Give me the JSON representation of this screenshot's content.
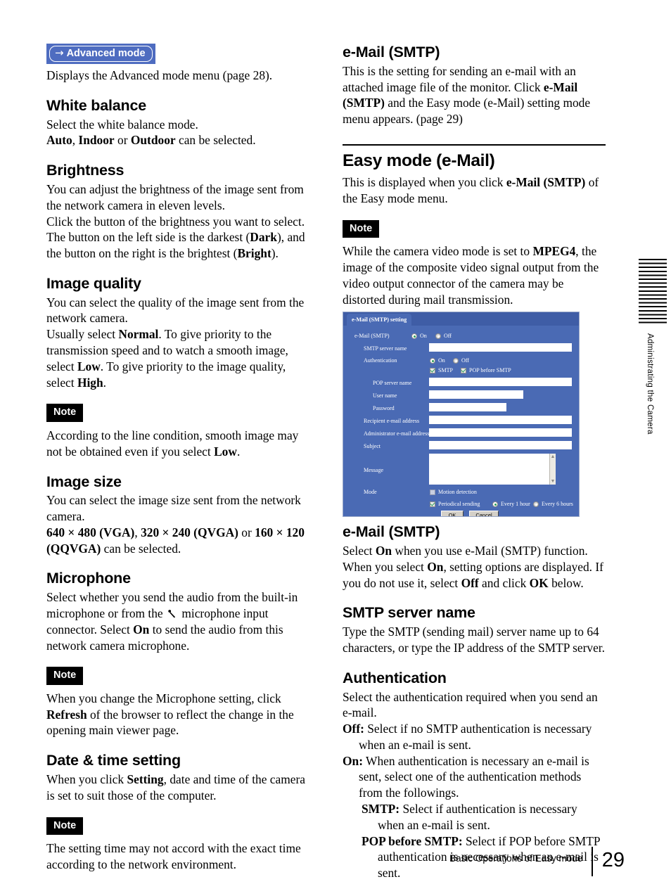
{
  "document": {
    "footer_text": "Basic Operations of Easy mode",
    "page_number": "29",
    "margin_chapter_label": "Administrating the Camera"
  },
  "left_column": {
    "advanced_mode_button": {
      "arrow": "→",
      "label": "Advanced mode"
    },
    "advanced_mode_caption": "Displays the Advanced mode menu (page 28).",
    "white_balance": {
      "heading": "White balance",
      "line1": "Select the white balance mode.",
      "line2_pre": "",
      "line2_b1": "Auto",
      "line2_mid1": ", ",
      "line2_b2": "Indoor",
      "line2_mid2": " or ",
      "line2_b3": "Outdoor",
      "line2_post": " can be selected."
    },
    "brightness": {
      "heading": "Brightness",
      "p1": "You can adjust the brightness of the image sent from the network camera in eleven levels.",
      "p2_pre": "Click the button of the brightness you want to select. The button on the left side is the darkest (",
      "p2_b1": "Dark",
      "p2_mid": "), and the button on the right is the brightest (",
      "p2_b2": "Bright",
      "p2_post": ")."
    },
    "image_quality": {
      "heading": "Image quality",
      "p1": "You can select the quality of the image sent from the network camera.",
      "p2_pre": "Usually select ",
      "p2_b1": "Normal",
      "p2_mid1": ". To give priority to the transmission speed and to watch a smooth image, select ",
      "p2_b2": "Low",
      "p2_mid2": ". To give priority to the image quality, select ",
      "p2_b3": "High",
      "p2_post": "."
    },
    "note1": {
      "tag": "Note",
      "pre": "According to the line condition, smooth image may not be obtained even if you select ",
      "b": "Low",
      "post": "."
    },
    "image_size": {
      "heading": "Image size",
      "p1": "You can select the image size sent from the network camera.",
      "p2_b1": "640 × 480 (VGA)",
      "p2_mid1": ", ",
      "p2_b2": "320 × 240 (QVGA)",
      "p2_mid2": " or ",
      "p2_b3": "160 × 120 (QQVGA)",
      "p2_post": " can be selected."
    },
    "microphone": {
      "heading": "Microphone",
      "p_pre": "Select whether you send the audio from the built-in microphone or from the ",
      "icon_name": "microphone-icon",
      "p_mid1": " microphone  input connector. Select ",
      "p_b1": "On",
      "p_post": " to send the audio from this network camera microphone."
    },
    "note2": {
      "tag": "Note",
      "pre": "When you change the Microphone setting, click ",
      "b": "Refresh",
      "post": " of the browser to reflect the change in the opening main viewer page."
    },
    "date_time": {
      "heading": "Date & time setting",
      "p_pre": "When you click ",
      "p_b": "Setting",
      "p_post": ", date and time of the camera is set to suit those of the computer."
    },
    "note3": {
      "tag": "Note",
      "text": "The setting time may not accord with the exact time according to the network environment."
    }
  },
  "right_column": {
    "email_smtp_intro": {
      "heading": "e-Mail (SMTP)",
      "p_pre": "This is the setting for sending an e-mail with an attached image file of the monitor. Click ",
      "p_b": "e-Mail (SMTP)",
      "p_post": " and the Easy mode (e-Mail) setting mode menu appears. (page 29)"
    },
    "easy_mode_section": {
      "heading": "Easy mode (e-Mail)",
      "p_pre": "This is displayed when you click ",
      "p_b": "e-Mail (SMTP)",
      "p_post": " of the Easy mode menu."
    },
    "note4": {
      "tag": "Note",
      "pre": "While the camera video mode is set to ",
      "b": "MPEG4",
      "post": ", the image of the composite video signal output from the video output connector of the camera may be distorted during mail transmission."
    },
    "email_smtp_option": {
      "heading": "e-Mail (SMTP)",
      "p_pre": "Select ",
      "p_b1": "On",
      "p_mid1": " when you use e-Mail (SMTP) function. When you select ",
      "p_b2": "On",
      "p_mid2": ", setting options are displayed. If you do not use it, select ",
      "p_b3": "Off",
      "p_mid3": " and click ",
      "p_b4": "OK",
      "p_post": " below."
    },
    "smtp_server_name": {
      "heading": "SMTP server name",
      "p": "Type the SMTP (sending mail) server name up to 64 characters, or type the IP address of the SMTP server."
    },
    "authentication": {
      "heading": "Authentication",
      "intro": "Select the authentication required when you send an e-mail.",
      "items": [
        {
          "term": "Off:",
          "text": " Select if no SMTP authentication is necessary when an e-mail is sent.",
          "level": 1
        },
        {
          "term": "On:",
          "text": " When authentication is necessary an e-mail is sent, select one of the authentication methods from the followings.",
          "level": 1
        },
        {
          "term": "SMTP:",
          "text": " Select if authentication is necessary when an e-mail is sent.",
          "level": 2
        },
        {
          "term": "POP before SMTP:",
          "text": " Select if POP before SMTP authentication is necessary when an e-mail is sent.",
          "level": 2
        }
      ]
    }
  },
  "screenshot": {
    "tab_label": "e-Mail (SMTP) setting",
    "top_row": {
      "label": "e-Mail (SMTP)",
      "option_on": "On",
      "option_off": "Off",
      "selected": "On"
    },
    "fields": {
      "smtp_server_name_label": "SMTP server name",
      "smtp_server_name_value": "",
      "authentication_label": "Authentication",
      "auth_on": "On",
      "auth_off": "Off",
      "auth_selected": "On",
      "chk_smtp": "SMTP",
      "chk_pop_before_smtp": "POP before SMTP",
      "pop_server_name_label": "POP server name",
      "pop_server_name_value": "",
      "user_name_label": "User name",
      "user_name_value": "",
      "password_label": "Password",
      "password_value": "",
      "recipient_label": "Recipient e-mail address",
      "recipient_value": "",
      "administrator_label": "Administrator e-mail address",
      "administrator_value": "",
      "subject_label": "Subject",
      "subject_value": "",
      "message_label": "Message",
      "message_value": "",
      "mode_label": "Mode",
      "motion_detection": "Motion detection",
      "periodical_sending": "Periodical sending",
      "every_1_hour": "Every 1 hour",
      "every_6_hours": "Every 6 hours"
    },
    "buttons": {
      "ok": "OK",
      "cancel": "Cancel"
    },
    "colors": {
      "panel_blue": "#4a6ab4",
      "tabbar_blue": "#3f5da6",
      "check_green": "#2e9e5b",
      "field_white": "#ffffff"
    }
  },
  "colors": {
    "advanced_button_blue": "#4e6cc0",
    "note_tag_background": "#000000",
    "note_tag_text": "#ffffff"
  }
}
